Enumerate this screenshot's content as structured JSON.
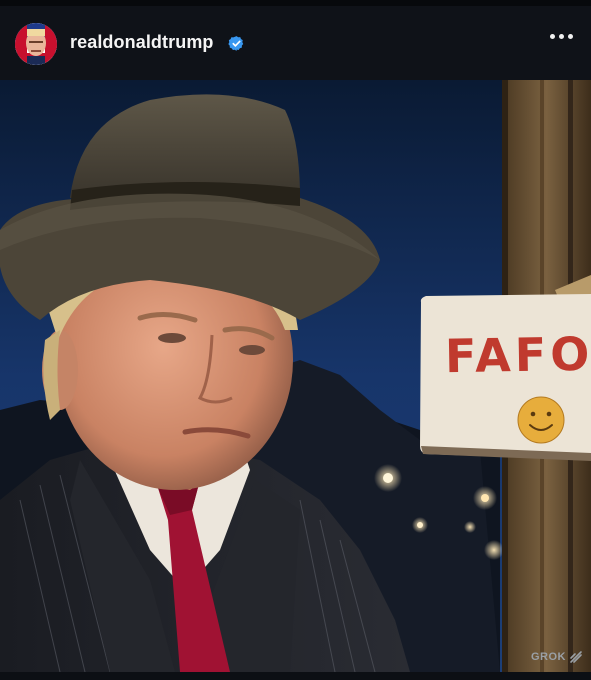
{
  "post": {
    "username": "realdonaldtrump",
    "verified_icon": "verified-badge-icon",
    "more_icon": "more-options-icon",
    "accent_color": "#3897f0"
  },
  "image": {
    "sign_text": "FAFO",
    "watermark": "GROK"
  }
}
